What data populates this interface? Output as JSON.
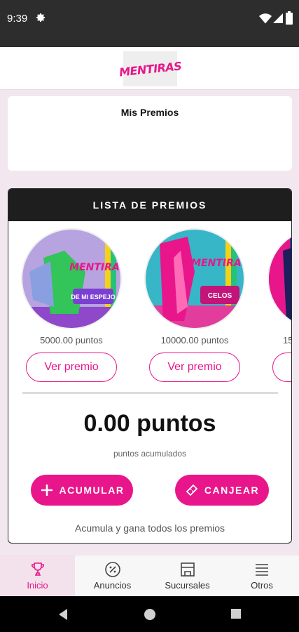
{
  "status": {
    "time": "9:39"
  },
  "header": {
    "logo_text": "MENTIRAS"
  },
  "mis_premios": {
    "title": "Mis Premios"
  },
  "lista": {
    "title": "LISTA DE PREMIOS",
    "prizes": [
      {
        "points": "5000.00 puntos",
        "button": "Ver premio",
        "image_caption": "DE MI ESPEJO"
      },
      {
        "points": "10000.00 puntos",
        "button": "Ver premio",
        "image_caption": "CELOS"
      },
      {
        "points": "15",
        "button": "V"
      }
    ],
    "points_value": "0.00 puntos",
    "points_label": "puntos acumulados",
    "acumular_label": "ACUMULAR",
    "canjear_label": "CANJEAR",
    "footer": "Acumula y gana todos los premios"
  },
  "nav": {
    "items": [
      {
        "label": "Inicio",
        "icon": "trophy-icon",
        "active": true
      },
      {
        "label": "Anuncios",
        "icon": "percent-icon"
      },
      {
        "label": "Sucursales",
        "icon": "store-icon"
      },
      {
        "label": "Otros",
        "icon": "menu-icon"
      }
    ]
  },
  "colors": {
    "accent": "#e8168a",
    "header_dark": "#1e1e1e",
    "background": "#f3e7ef"
  }
}
